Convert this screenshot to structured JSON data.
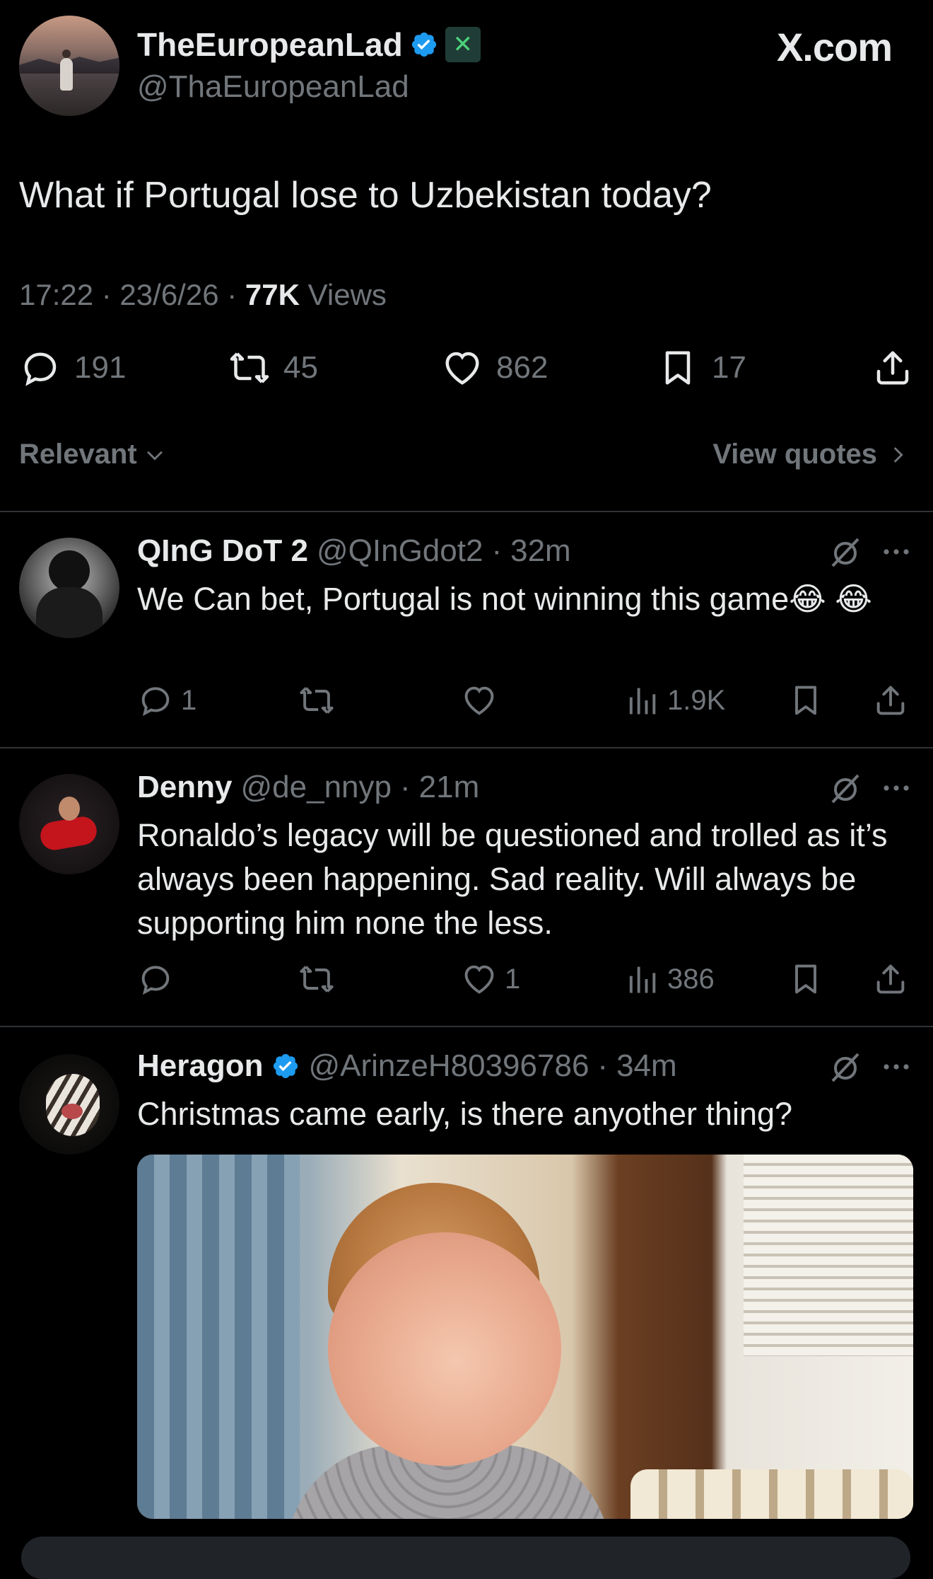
{
  "main_tweet": {
    "display_name": "TheEuropeanLad",
    "handle": "@ThaEuropeanLad",
    "watermark": "X.com",
    "text": "What if Portugal lose to Uzbekistan today?",
    "time": "17:22 · 23/6/26 · ",
    "views_count": "77K",
    "views_label": " Views",
    "stats": {
      "replies": "191",
      "reposts": "45",
      "likes": "862",
      "bookmarks": "17"
    }
  },
  "sort": {
    "label": "Relevant",
    "quotes": "View quotes"
  },
  "replies": [
    {
      "name": "QInG DoT 2",
      "handle": "@QInGdot2",
      "sep": "·",
      "time": "32m",
      "text": "We Can bet, Portugal is not winning this game😂 😂",
      "replies": "1",
      "reposts": "",
      "likes": "",
      "views": "1.9K"
    },
    {
      "name": "Denny",
      "handle": "@de_nnyp",
      "sep": "·",
      "time": "21m",
      "text": "Ronaldo’s legacy will be questioned and trolled as it’s always been happening. Sad reality. Will always be supporting him none the less.",
      "replies": "",
      "reposts": "",
      "likes": "1",
      "views": "386"
    },
    {
      "name": "Heragon",
      "handle": "@ArinzeH80396786",
      "sep": "·",
      "time": "34m",
      "text": "Christmas came early, is there anyother thing?",
      "media": "baby-frowning-photo"
    }
  ],
  "colors": {
    "background": "#000000",
    "text": "#e7e9ea",
    "secondary": "#71767b",
    "verified": "#1d9bf0",
    "divider": "#2f3336"
  }
}
